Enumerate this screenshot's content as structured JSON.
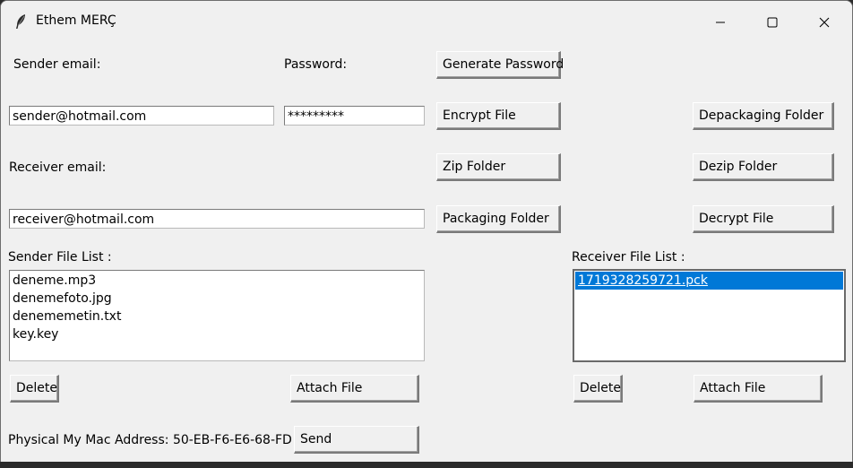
{
  "window": {
    "title": "Ethem MERÇ"
  },
  "form": {
    "sender_email_label": "Sender email:",
    "password_label": "Password:",
    "sender_email_value": "sender@hotmail.com",
    "password_value": "*********",
    "receiver_email_label": "Receiver email:",
    "receiver_email_value": "receiver@hotmail.com",
    "mac_address_label": "Physical My Mac Address: 50-EB-F6-E6-68-FD"
  },
  "buttons": {
    "generate_password": "Generate Password",
    "encrypt_file": "Encrypt File",
    "zip_folder": "Zip Folder",
    "packaging_folder": "Packaging Folder",
    "depackaging_folder": "Depackaging Folder",
    "dezip_folder": "Dezip Folder",
    "decrypt_file": "Decrypt File",
    "sender_delete": "Delete",
    "sender_attach": "Attach File",
    "receiver_delete": "Delete",
    "receiver_attach": "Attach File",
    "send": "Send"
  },
  "sender_list": {
    "label": "Sender File List :",
    "items": [
      "deneme.mp3",
      "denemefoto.jpg",
      "denememetin.txt",
      "key.key"
    ]
  },
  "receiver_list": {
    "label": "Receiver File List :",
    "items": [
      "1719328259721.pck"
    ],
    "selected_index": 0
  },
  "colors": {
    "selection": "#0078d7",
    "window_bg": "#f0f0f0"
  }
}
